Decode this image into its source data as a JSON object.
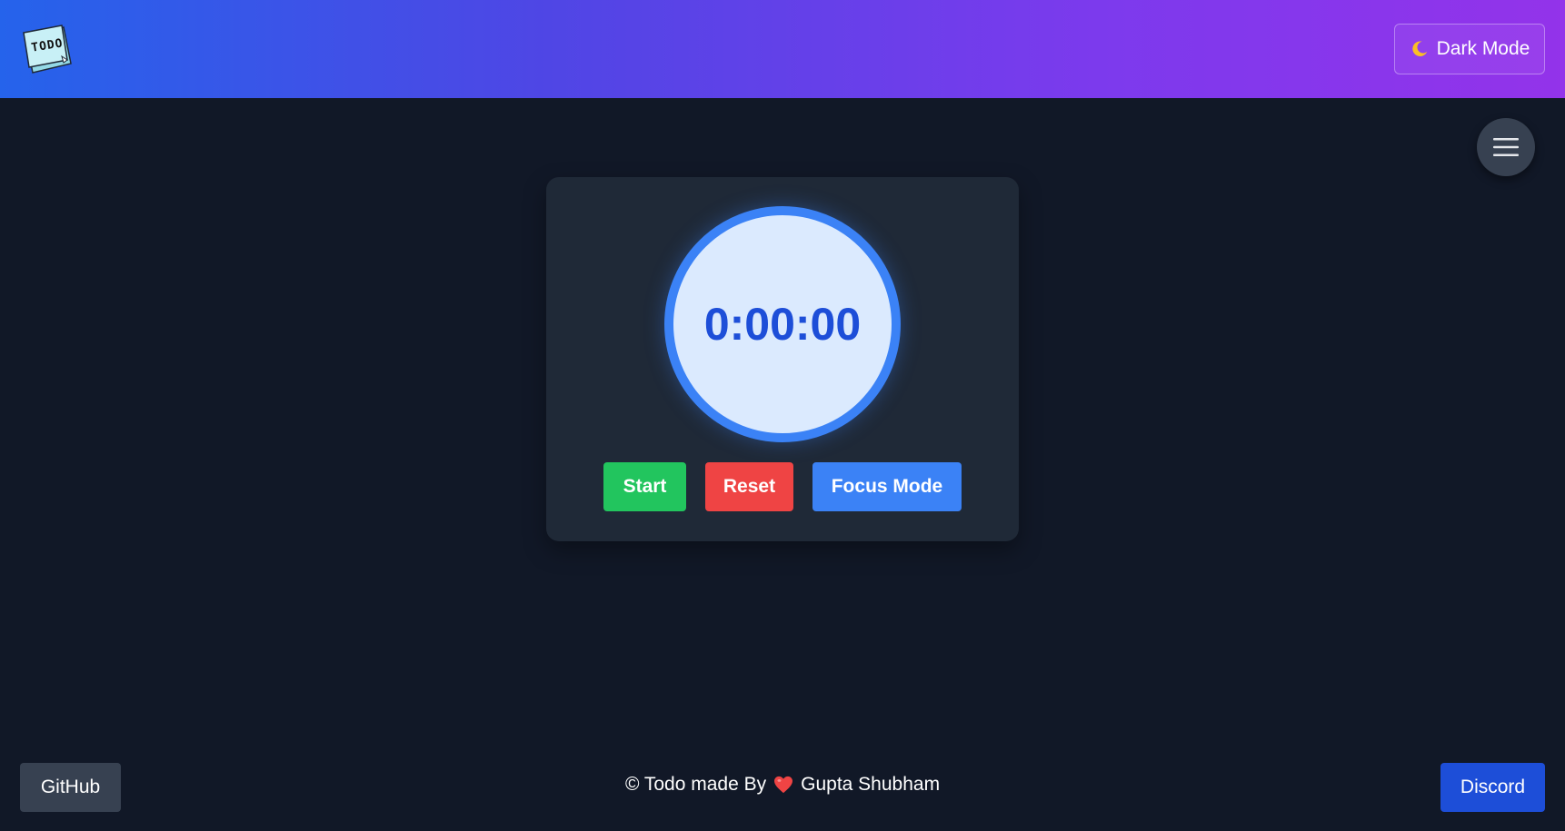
{
  "header": {
    "logo_text": "TODO",
    "dark_mode_label": "Dark Mode"
  },
  "timer": {
    "display": "0:00:00",
    "start_label": "Start",
    "reset_label": "Reset",
    "focus_label": "Focus Mode"
  },
  "footer": {
    "github_label": "GitHub",
    "credit_prefix": "© Todo made By",
    "credit_author": "Gupta Shubham",
    "discord_label": "Discord"
  },
  "icons": {
    "logo": "todo-note-icon",
    "dark_mode": "moon-icon",
    "menu": "hamburger-menu-icon",
    "credit": "heart-icon"
  },
  "colors": {
    "header_gradient": [
      "#2563eb",
      "#9333ea"
    ],
    "background": "#111827",
    "card": "#1f2937",
    "timer_ring": "#3b82f6",
    "timer_face": "#dbeafe",
    "timer_text": "#1d4ed8",
    "start": "#22c55e",
    "reset": "#ef4444",
    "focus": "#3b82f6",
    "github": "#374151",
    "discord": "#1d4ed8"
  }
}
